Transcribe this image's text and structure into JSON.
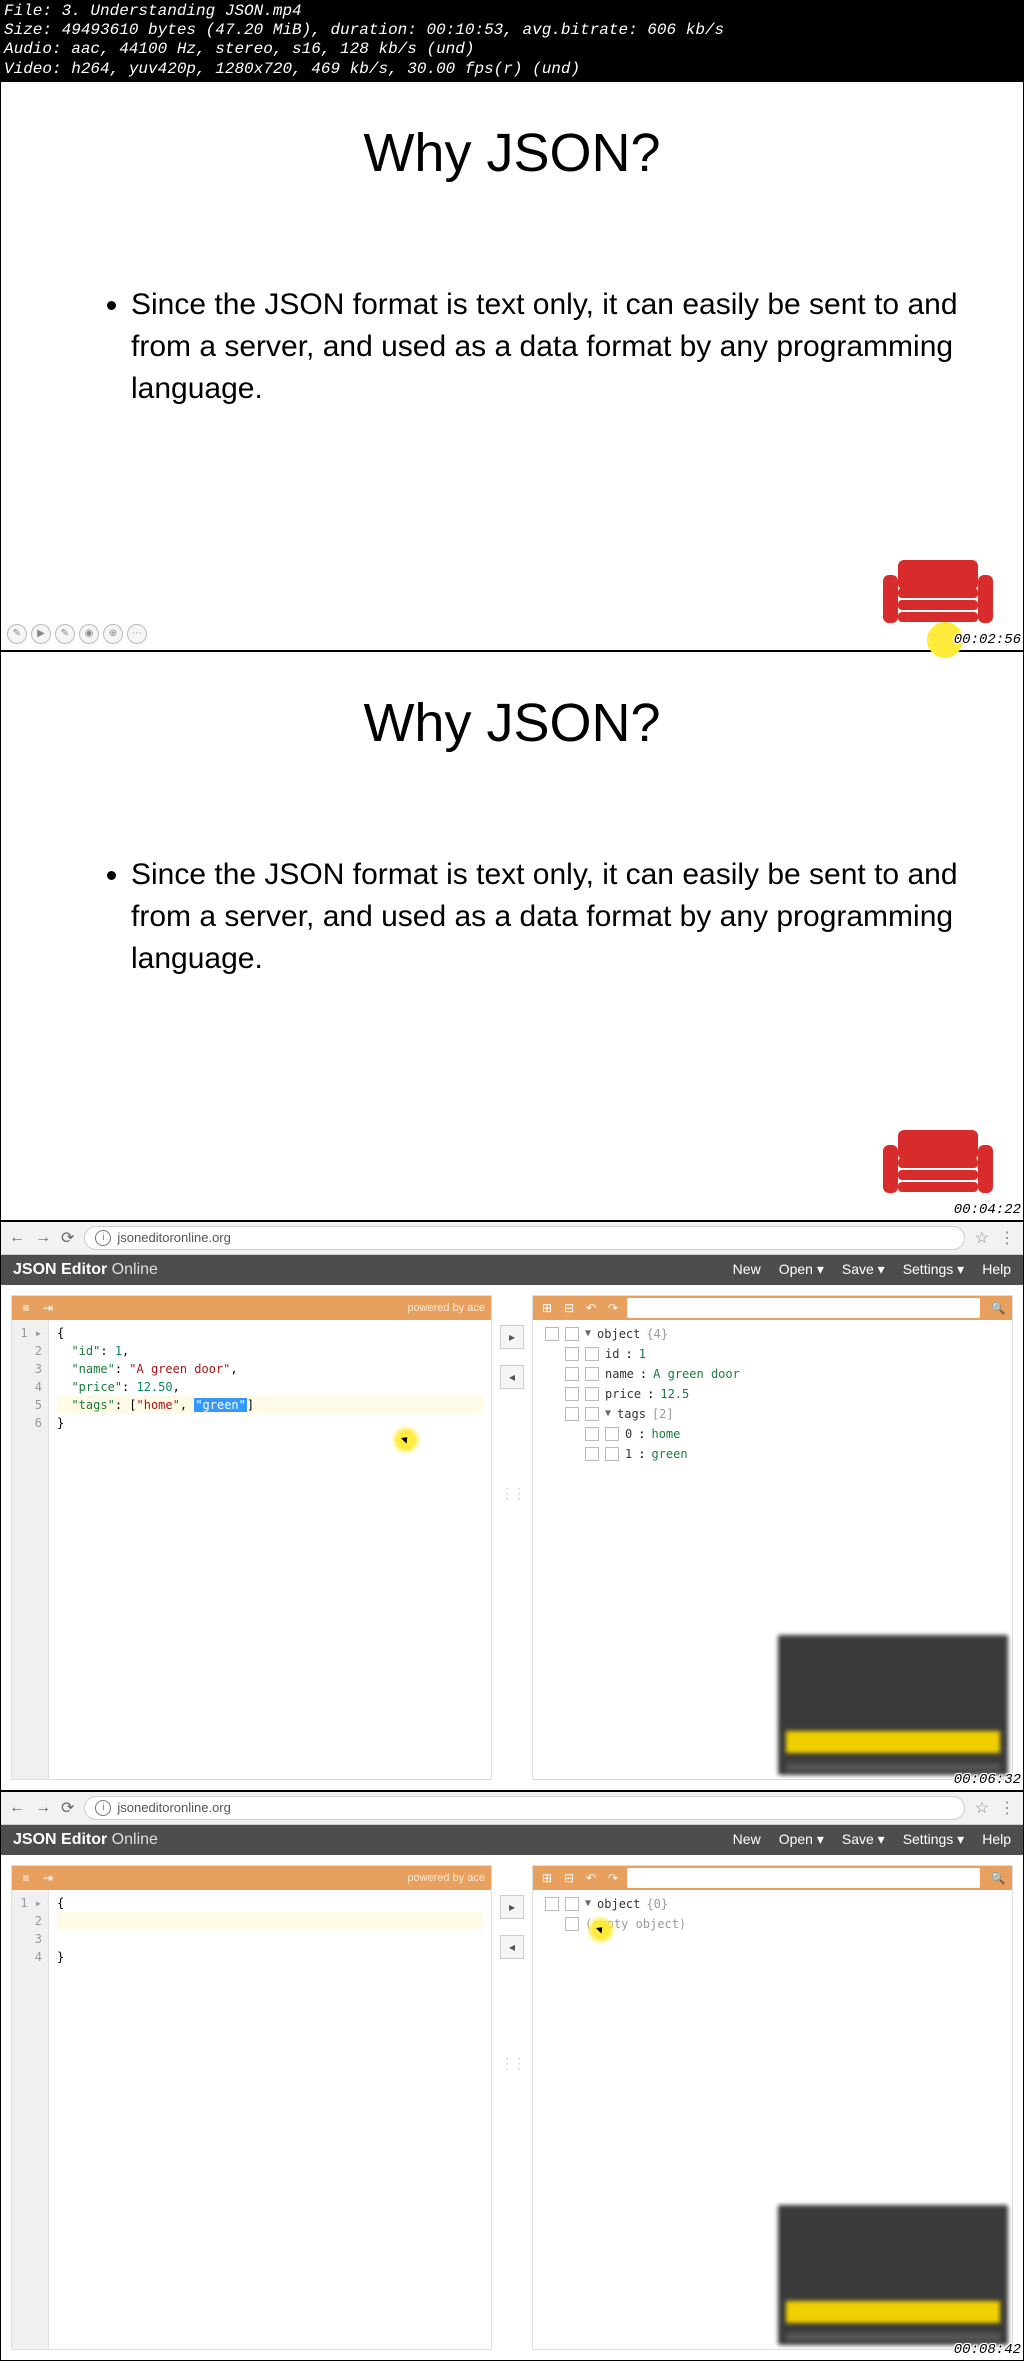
{
  "meta": {
    "line1": "File: 3. Understanding JSON.mp4",
    "line2": "Size: 49493610 bytes (47.20 MiB), duration: 00:10:53, avg.bitrate: 606 kb/s",
    "line3": "Audio: aac, 44100 Hz, stereo, s16, 128 kb/s (und)",
    "line4": "Video: h264, yuv420p, 1280x720, 469 kb/s, 30.00 fps(r) (und)"
  },
  "slide1": {
    "title": "Why JSON?",
    "bullet": "Since the JSON format is text only, it can easily be sent to and from a server, and used as a data format by any programming language.",
    "timestamp": "00:02:56"
  },
  "slide2": {
    "title": "Why JSON?",
    "bullet": "Since the JSON format is text only, it can easily be sent to and from a server, and used as a data format by any programming language.",
    "timestamp": "00:04:22"
  },
  "browser": {
    "url": "jsoneditoronline.org"
  },
  "app": {
    "title_bold": "JSON Editor",
    "title_light": " Online",
    "menu": {
      "new": "New",
      "open": "Open ▾",
      "save": "Save ▾",
      "settings": "Settings ▾",
      "help": "Help"
    },
    "toolbar_right": "powered by ace"
  },
  "frame3": {
    "timestamp": "00:06:32",
    "code": {
      "l1": "{",
      "l2_key": "\"id\"",
      "l2_val": "1",
      "l3_key": "\"name\"",
      "l3_val": "\"A green door\"",
      "l4_key": "\"price\"",
      "l4_val": "12.50",
      "l5_key": "\"tags\"",
      "l5_v1": "\"home\"",
      "l5_v2": "\"green\"",
      "l6": "}"
    },
    "tree": {
      "root": "object",
      "root_count": "{4}",
      "id_key": "id",
      "id_val": "1",
      "name_key": "name",
      "name_val": "A green door",
      "price_key": "price",
      "price_val": "12.5",
      "tags_key": "tags",
      "tags_count": "[2]",
      "t0_key": "0",
      "t0_val": "home",
      "t1_key": "1",
      "t1_val": "green"
    }
  },
  "frame4": {
    "timestamp": "00:08:42",
    "code": {
      "l1": "{",
      "l2": "",
      "l3": "",
      "l4": "}"
    },
    "tree": {
      "root": "object",
      "root_count": "{0}",
      "empty": "(empty object)"
    }
  },
  "sep": ":"
}
